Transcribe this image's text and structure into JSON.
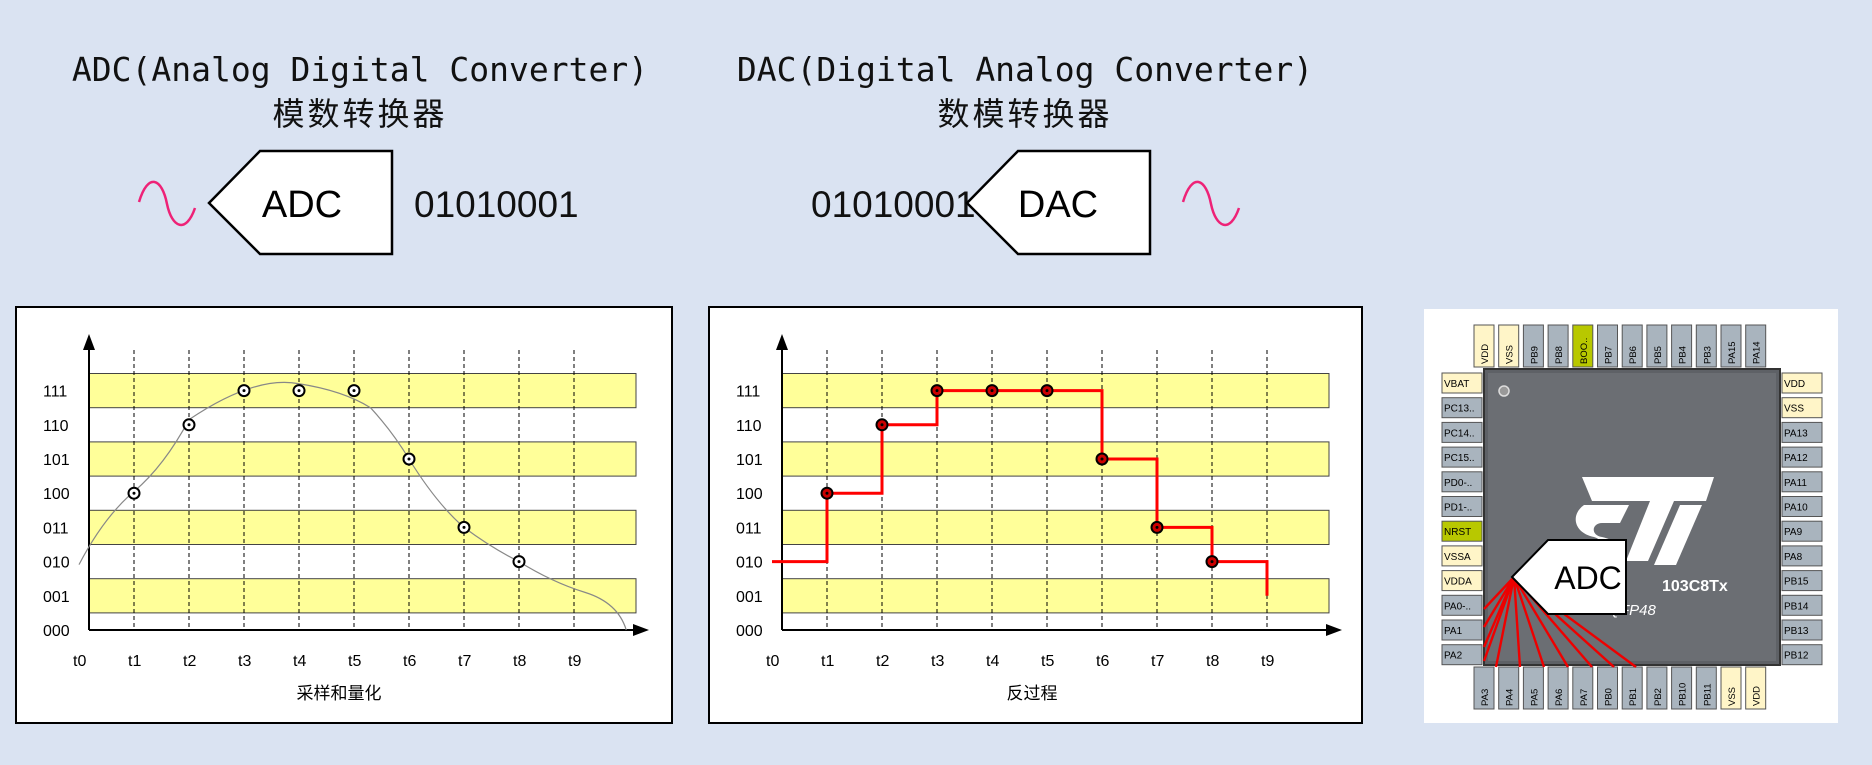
{
  "adc_title": {
    "line1": "ADC(Analog Digital Converter)",
    "line2": "模数转换器"
  },
  "dac_title": {
    "line1": "DAC(Digital Analog Converter)",
    "line2": "数模转换器"
  },
  "adc_block": {
    "label": "ADC",
    "output_bits": "01010001"
  },
  "dac_block": {
    "label": "DAC",
    "input_bits": "01010001"
  },
  "colors": {
    "band": "#ffff99",
    "step": "#ff0000",
    "wave": "#ee2277",
    "background": "#dae3f2"
  },
  "chart_data": [
    {
      "type": "scatter",
      "caption": "采样和量化",
      "y_levels": [
        "000",
        "001",
        "010",
        "011",
        "100",
        "101",
        "110",
        "111"
      ],
      "x_ticks": [
        "t0",
        "t1",
        "t2",
        "t3",
        "t4",
        "t5",
        "t6",
        "t7",
        "t8",
        "t9"
      ],
      "points": [
        {
          "x": "t1",
          "y": "100"
        },
        {
          "x": "t2",
          "y": "110"
        },
        {
          "x": "t3",
          "y": "111"
        },
        {
          "x": "t4",
          "y": "111"
        },
        {
          "x": "t5",
          "y": "111"
        },
        {
          "x": "t6",
          "y": "101"
        },
        {
          "x": "t7",
          "y": "011"
        },
        {
          "x": "t8",
          "y": "010"
        }
      ],
      "curve": true
    },
    {
      "type": "line",
      "caption": "反过程",
      "y_levels": [
        "000",
        "001",
        "010",
        "011",
        "100",
        "101",
        "110",
        "111"
      ],
      "x_ticks": [
        "t0",
        "t1",
        "t2",
        "t3",
        "t4",
        "t5",
        "t6",
        "t7",
        "t8",
        "t9"
      ],
      "step_values": [
        "010",
        "100",
        "110",
        "111",
        "111",
        "111",
        "101",
        "011",
        "010",
        "001"
      ],
      "points": [
        {
          "x": "t1",
          "y": "100"
        },
        {
          "x": "t2",
          "y": "110"
        },
        {
          "x": "t3",
          "y": "111"
        },
        {
          "x": "t4",
          "y": "111"
        },
        {
          "x": "t5",
          "y": "111"
        },
        {
          "x": "t6",
          "y": "101"
        },
        {
          "x": "t7",
          "y": "011"
        },
        {
          "x": "t8",
          "y": "010"
        }
      ]
    }
  ],
  "chip": {
    "logo": "ST",
    "part": "103C8Tx",
    "package": "LQFP48",
    "adc_label": "ADC",
    "top_pins": [
      "VDD",
      "VSS",
      "PB9",
      "PB8",
      "BOO..",
      "PB7",
      "PB6",
      "PB5",
      "PB4",
      "PB3",
      "PA15",
      "PA14"
    ],
    "left_pins": [
      "VBAT",
      "PC13..",
      "PC14..",
      "PC15..",
      "PD0-..",
      "PD1-..",
      "NRST",
      "VSSA",
      "VDDA",
      "PA0-..",
      "PA1",
      "PA2"
    ],
    "right_pins": [
      "VDD",
      "VSS",
      "PA13",
      "PA12",
      "PA11",
      "PA10",
      "PA9",
      "PA8",
      "PB15",
      "PB14",
      "PB13",
      "PB12"
    ],
    "bottom_pins": [
      "PA3",
      "PA4",
      "PA5",
      "PA6",
      "PA7",
      "PB0",
      "PB1",
      "PB2",
      "PB10",
      "PB11",
      "VSS",
      "VDD"
    ],
    "pin_colors": {
      "power": "#fff5c8",
      "boot": "#b8c800",
      "reset": "#b8c800",
      "normal": "#a9b4be"
    }
  }
}
